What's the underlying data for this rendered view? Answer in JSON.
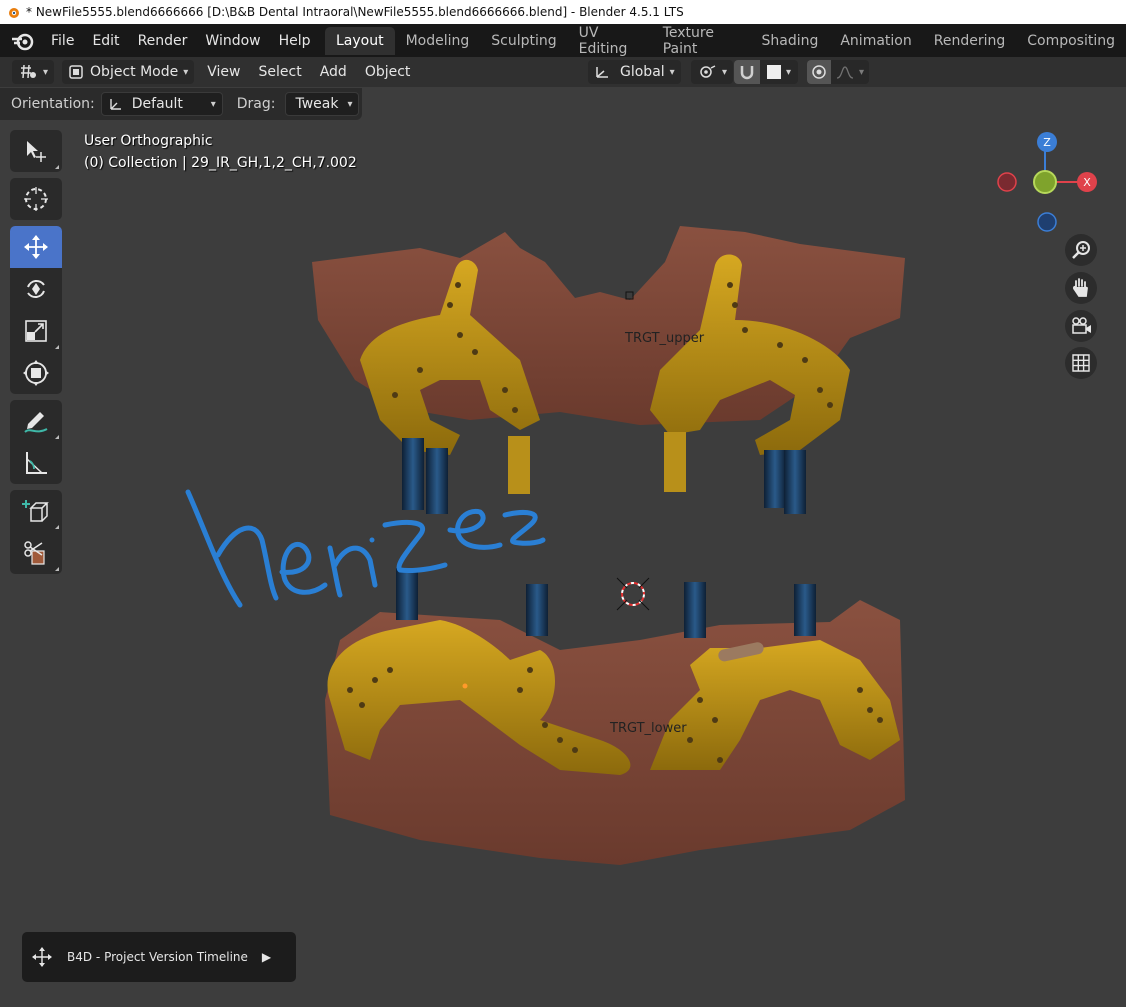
{
  "title_bar": {
    "text": "* NewFile5555.blend6666666 [D:\\B&B Dental Intraoral\\NewFile5555.blend6666666.blend] - Blender 4.5.1 LTS"
  },
  "menu": [
    "File",
    "Edit",
    "Render",
    "Window",
    "Help"
  ],
  "workspace_tabs": [
    {
      "label": "Layout",
      "active": true
    },
    {
      "label": "Modeling"
    },
    {
      "label": "Sculpting"
    },
    {
      "label": "UV Editing"
    },
    {
      "label": "Texture Paint"
    },
    {
      "label": "Shading"
    },
    {
      "label": "Animation"
    },
    {
      "label": "Rendering"
    },
    {
      "label": "Compositing"
    }
  ],
  "header": {
    "mode": "Object Mode",
    "menus": [
      "View",
      "Select",
      "Add",
      "Object"
    ],
    "transform_orientation": "Global"
  },
  "tool_settings": {
    "orientation_label": "Orientation:",
    "orientation_value": "Default",
    "drag_label": "Drag:",
    "drag_value": "Tweak"
  },
  "viewport_info": {
    "view": "User Orthographic",
    "collection": "(0) Collection | 29_IR_GH,1,2_CH,7.002"
  },
  "gizmo": {
    "z": "Z",
    "x": "X"
  },
  "scene_labels": {
    "upper": "TRGT_upper",
    "lower": "TRGT_lower",
    "handwriting": "henzez"
  },
  "bottom_panel": {
    "label": "B4D - Project Version Timeline"
  },
  "colors": {
    "tissue": "#7a4535",
    "guide": "#b58a14",
    "implant": "#1f3d63",
    "active_tool": "#4a74c9"
  }
}
